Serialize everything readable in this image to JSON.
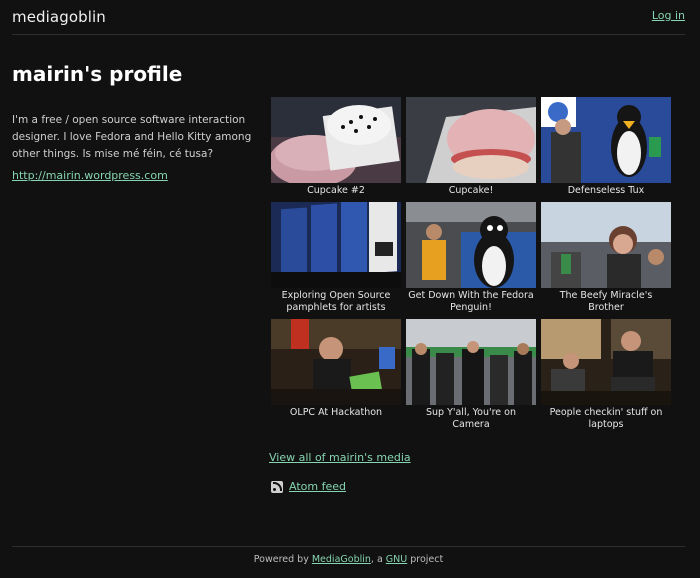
{
  "header": {
    "logo": "mediagoblin",
    "login": "Log in"
  },
  "profile": {
    "title": "mairin's profile",
    "bio": "I'm a free / open source software interaction designer. I love Fedora and Hello Kitty among other things. Is mise mé féin, cé tusa?",
    "link": "http://mairin.wordpress.com"
  },
  "gallery": {
    "items": [
      {
        "caption": "Cupcake #2",
        "image": "cupcake-photo"
      },
      {
        "caption": "Cupcake!",
        "image": "cupcake-photo"
      },
      {
        "caption": "Defenseless Tux",
        "image": "tux-mascot-photo"
      },
      {
        "caption": "Exploring Open Source pamphlets for artists",
        "image": "pamphlets-photo"
      },
      {
        "caption": "Get Down With the Fedora Penguin!",
        "image": "penguin-costume-photo"
      },
      {
        "caption": "The Beefy Miracle's Brother",
        "image": "crowd-photo"
      },
      {
        "caption": "OLPC At Hackathon",
        "image": "hackathon-photo"
      },
      {
        "caption": "Sup Y'all, You're on Camera",
        "image": "camera-crowd-photo"
      },
      {
        "caption": "People checkin' stuff on laptops",
        "image": "laptops-photo"
      }
    ],
    "view_all": "View all of mairin's media",
    "atom_feed": "Atom feed"
  },
  "footer": {
    "prefix": "Powered by ",
    "mediagoblin": "MediaGoblin",
    "middle": ", a ",
    "gnu": "GNU",
    "suffix": " project"
  },
  "colors": {
    "background": "#111111",
    "link": "#86d4b1"
  }
}
